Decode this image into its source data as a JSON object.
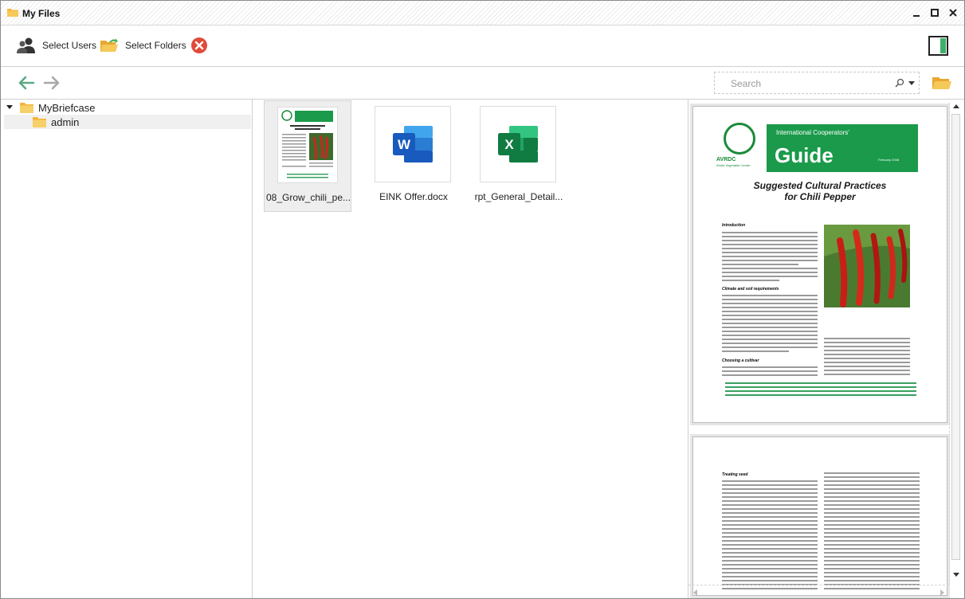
{
  "window": {
    "title": "My Files"
  },
  "toolbar": {
    "select_users_label": "Select Users",
    "select_folders_label": "Select Folders"
  },
  "navigation": {
    "search": {
      "placeholder": "Search",
      "value": ""
    }
  },
  "tree": {
    "root": {
      "label": "MyBriefcase",
      "expanded": true
    },
    "children": [
      {
        "label": "admin",
        "selected": true
      }
    ]
  },
  "files": [
    {
      "name": "08_Grow_chili_pe...",
      "type": "pdf",
      "selected": true
    },
    {
      "name": "EINK Offer.docx",
      "type": "word",
      "selected": false
    },
    {
      "name": "rpt_General_Detail...",
      "type": "excel",
      "selected": false
    }
  ],
  "preview": {
    "banner_header": "International Cooperators'",
    "banner_title": "Guide",
    "banner_date": "February 2008",
    "logo_text": "AVRDC",
    "logo_subtitle": "World Vegetable Center",
    "doc_title_line1": "Suggested Cultural Practices",
    "doc_title_line2": "for Chili Pepper",
    "section_intro": "Introduction",
    "section_climate": "Climate and soil requirements",
    "section_cultivar": "Choosing a cultivar",
    "section_seed": "Treating seed"
  },
  "colors": {
    "accent_green": "#1a9a4a",
    "word_blue": "#2b579a",
    "excel_green": "#217346",
    "cancel_red": "#e04a3a"
  }
}
